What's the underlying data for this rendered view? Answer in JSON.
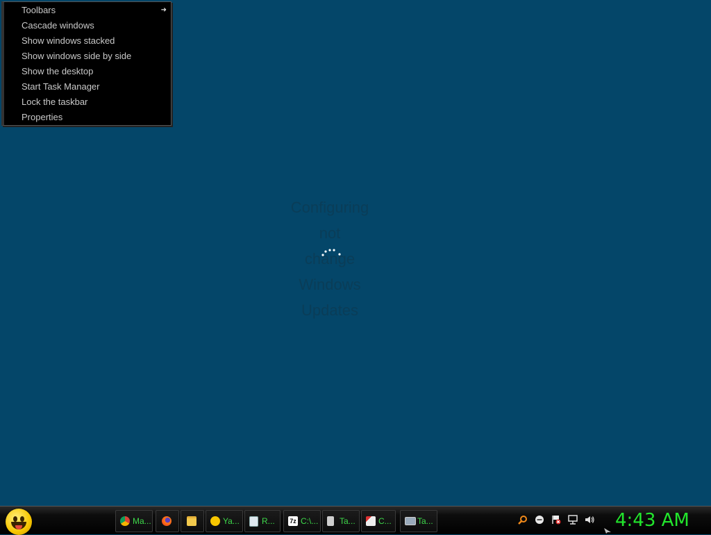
{
  "context_menu": {
    "items": [
      {
        "label": "Toolbars",
        "has_submenu": true
      },
      {
        "label": "Cascade windows"
      },
      {
        "label": "Show windows stacked"
      },
      {
        "label": "Show windows side by side"
      },
      {
        "label": "Show the desktop"
      },
      {
        "label": "Start Task Manager"
      },
      {
        "label": "Lock the taskbar"
      },
      {
        "label": "Properties"
      }
    ],
    "submenu_arrow": "➜"
  },
  "update_overlay": {
    "lines": [
      "Configuring",
      "not",
      "change",
      "Windows",
      "Updates"
    ]
  },
  "taskbar": {
    "buttons": [
      {
        "label": "Ma...",
        "icon": "chrome-icon"
      },
      {
        "label": "",
        "icon": "firefox-icon"
      },
      {
        "label": "",
        "icon": "folder-icon"
      },
      {
        "label": "Ya...",
        "icon": "yahoo-messenger-icon"
      },
      {
        "label": "R...",
        "icon": "notepad-icon"
      },
      {
        "label": "C:\\...",
        "icon": "7zip-icon"
      },
      {
        "label": "Ta...",
        "icon": "task-icon"
      },
      {
        "label": "C...",
        "icon": "paint-icon"
      },
      {
        "label": "Ta...",
        "icon": "monitor-icon"
      }
    ],
    "tray_icons": [
      "search-icon",
      "messenger-icon",
      "flag-icon",
      "network-icon",
      "volume-icon"
    ],
    "clock": "4:43 AM"
  },
  "colors": {
    "desktop": "#044669",
    "taskbar_text": "#3ed84a",
    "clock": "#22e52c"
  }
}
